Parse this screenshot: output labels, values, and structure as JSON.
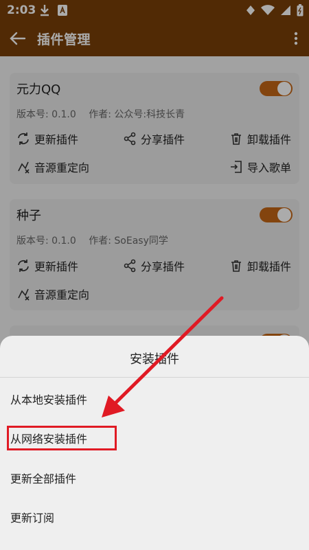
{
  "status_bar": {
    "time": "2:03"
  },
  "app_bar": {
    "title": "插件管理"
  },
  "plugins": [
    {
      "name": "元力QQ",
      "version": "版本号: 0.1.0",
      "author": "作者: 公众号:科技长青",
      "enabled": true,
      "actions": {
        "update": "更新插件",
        "share": "分享插件",
        "uninstall": "卸载插件",
        "redirect": "音源重定向",
        "import": "导入歌单"
      }
    },
    {
      "name": "种子",
      "version": "版本号: 0.1.0",
      "author": "作者: SoEasy同学",
      "enabled": true,
      "actions": {
        "update": "更新插件",
        "share": "分享插件",
        "uninstall": "卸载插件",
        "redirect": "音源重定向"
      }
    }
  ],
  "sheet": {
    "title": "安装插件",
    "options": [
      "从本地安装插件",
      "从网络安装插件",
      "更新全部插件",
      "更新订阅"
    ]
  },
  "colors": {
    "app_bar": "#7a3f08",
    "accent": "#c46616",
    "annotation": "#e01a24"
  }
}
